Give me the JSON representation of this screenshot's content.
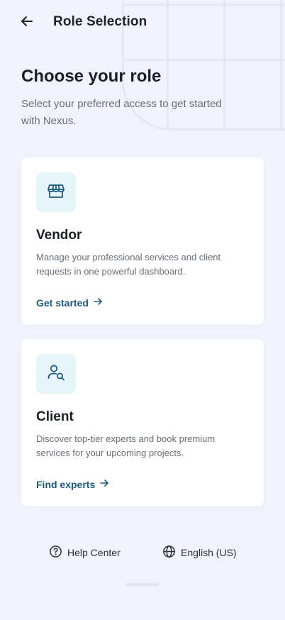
{
  "header": {
    "title": "Role Selection",
    "back_icon": "arrow-left-icon"
  },
  "intro": {
    "title": "Choose your role",
    "subtitle": "Select your preferred access to get started with Nexus."
  },
  "roles": [
    {
      "icon": "storefront-icon",
      "title": "Vendor",
      "description": "Manage your professional services and client requests in one powerful dashboard.",
      "action_label": "Get started"
    },
    {
      "icon": "user-search-icon",
      "title": "Client",
      "description": "Discover top-tier experts and book premium services for your upcoming projects.",
      "action_label": "Find experts"
    }
  ],
  "footer": {
    "help_label": "Help Center",
    "language_label": "English (US)"
  },
  "colors": {
    "background": "#f0f2fc",
    "accent": "#1d5a80",
    "icon_tile": "#e6f5f9",
    "card": "#ffffff"
  }
}
